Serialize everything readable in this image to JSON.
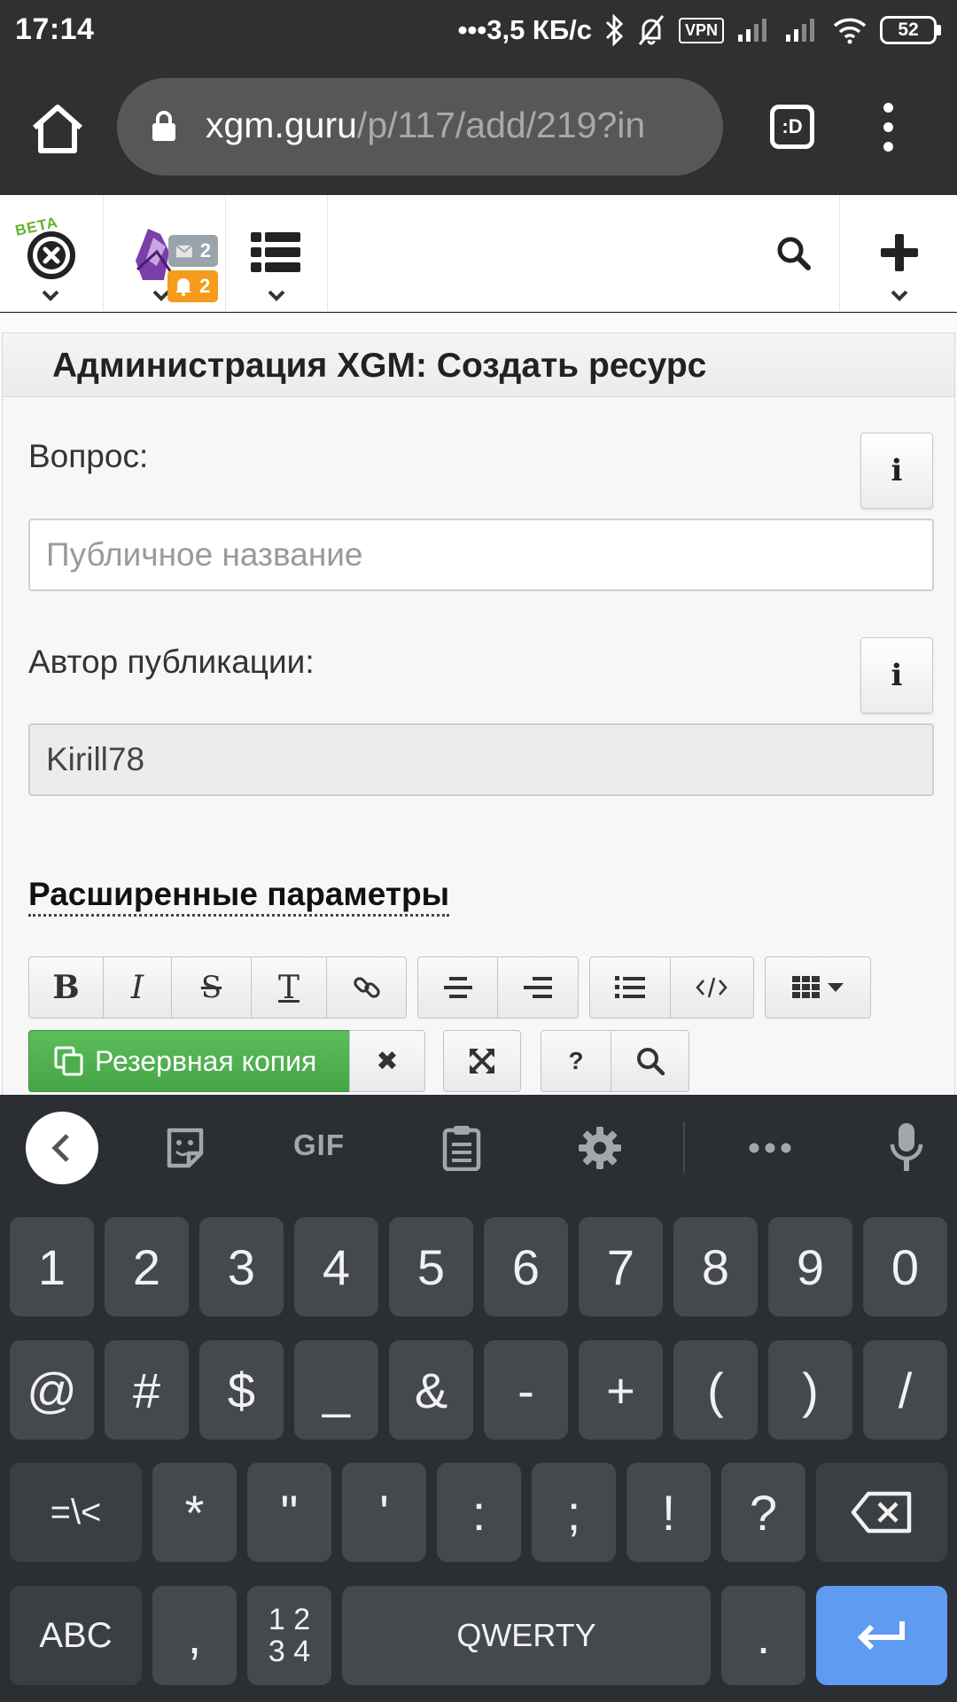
{
  "status_bar": {
    "time": "17:14",
    "speed": "3,5 КБ/с",
    "vpn": "VPN",
    "battery": "52"
  },
  "browser": {
    "url_host": "xgm.guru",
    "url_path": "/p/117/add/219?in",
    "tabs_label": ":D"
  },
  "header": {
    "beta": "BETA",
    "mail_count": "2",
    "notif_count": "2"
  },
  "page": {
    "title": "Администрация XGM: Создать ресурс",
    "question_label": "Вопрос:",
    "question_placeholder": "Публичное название",
    "author_label": "Автор публикации:",
    "author_value": "Kirill78",
    "advanced_link": "Расширенные параметры",
    "info_glyph": "i",
    "toolbar": {
      "bold": "B",
      "italic": "I",
      "strike": "S",
      "text": "T",
      "backup_label": "Резервная копия",
      "close_glyph": "✖",
      "help_glyph": "?"
    }
  },
  "keyboard": {
    "gif": "GIF",
    "row1": [
      "1",
      "2",
      "3",
      "4",
      "5",
      "6",
      "7",
      "8",
      "9",
      "0"
    ],
    "row2": [
      "@",
      "#",
      "$",
      "_",
      "&",
      "-",
      "+",
      "(",
      ")",
      "/"
    ],
    "row3": [
      "=\\<",
      "*",
      "\"",
      "'",
      ":",
      ";",
      "!",
      "?"
    ],
    "abc": "ABC",
    "comma": ",",
    "num_top": "1 2",
    "num_bottom": "3 4",
    "space": "QWERTY",
    "period": "."
  }
}
